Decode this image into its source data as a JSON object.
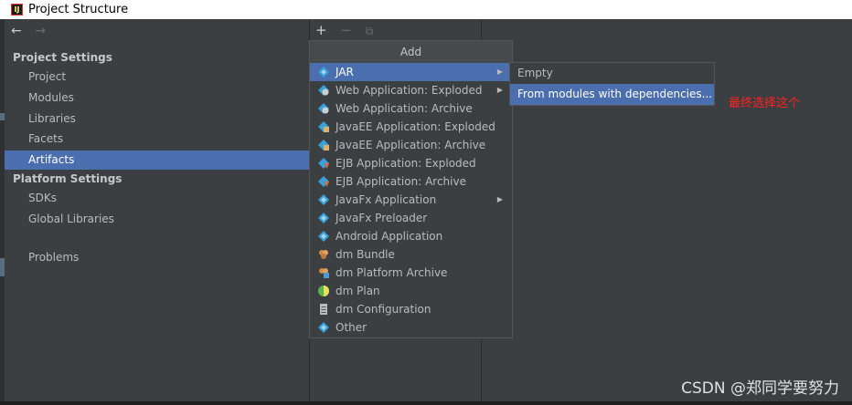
{
  "window": {
    "title": "Project Structure",
    "app_icon_letter": "IJ"
  },
  "nav": {
    "back": "←",
    "forward": "→"
  },
  "sidebar": {
    "project_settings_header": "Project Settings",
    "project_items": [
      "Project",
      "Modules",
      "Libraries",
      "Facets",
      "Artifacts"
    ],
    "selected": "Artifacts",
    "platform_settings_header": "Platform Settings",
    "platform_items": [
      "SDKs",
      "Global Libraries"
    ],
    "problems": "Problems"
  },
  "toolbar": {
    "add": "+",
    "remove": "−",
    "copy": "⧉"
  },
  "popup": {
    "title": "Add",
    "items": [
      "JAR",
      "Web Application: Exploded",
      "Web Application: Archive",
      "JavaEE Application: Exploded",
      "JavaEE Application: Archive",
      "EJB Application: Exploded",
      "EJB Application: Archive",
      "JavaFx Application",
      "JavaFx Preloader",
      "Android Application",
      "dm Bundle",
      "dm Platform Archive",
      "dm Plan",
      "dm Configuration",
      "Other"
    ],
    "selected": "JAR",
    "submenu_arrow": "▶"
  },
  "submenu": {
    "items": [
      "Empty",
      "From modules with dependencies..."
    ],
    "selected": "From modules with dependencies..."
  },
  "annotation": "最终选择这个",
  "watermark": "CSDN @郑同学要努力",
  "colors": {
    "selection": "#4b6eaf",
    "background": "#3c3f41",
    "annotation": "#ff2020"
  }
}
